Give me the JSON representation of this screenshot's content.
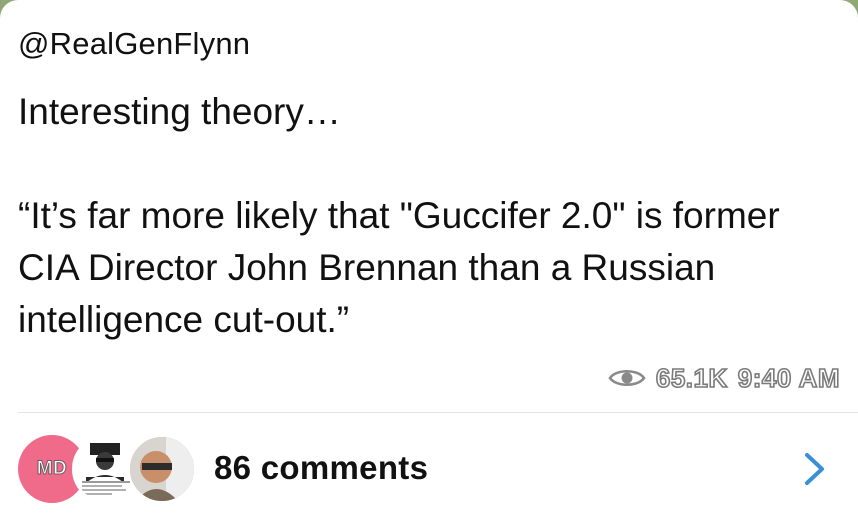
{
  "post": {
    "author": "@RealGenFlynn",
    "text": "Interesting theory…\n\n“It’s far more likely that \"Guccifer 2.0\" is former CIA Director John Brennan than a Russian intelligence cut-out.”",
    "views": "65.1K",
    "time": "9:40 AM"
  },
  "comments": {
    "label": "86 comments",
    "avatar_initials": "MD"
  },
  "colors": {
    "accent_link": "#3a8fd8",
    "avatar_pink": "#f06b8a",
    "background": "#8fa876"
  },
  "icons": {
    "views": "eye-icon",
    "open": "chevron-right-icon"
  }
}
